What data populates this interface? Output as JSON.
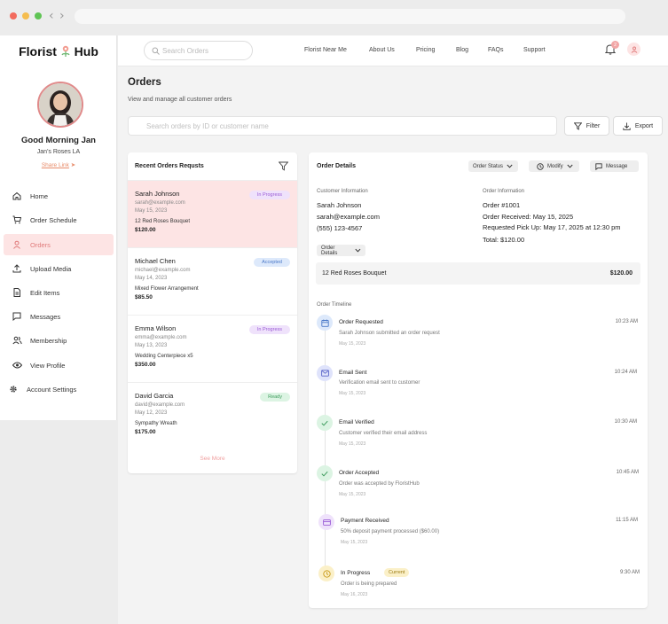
{
  "browser": {
    "url": ""
  },
  "brand": {
    "name_left": "Florist",
    "name_right": "Hub",
    "accent": "#e07a7a"
  },
  "profile": {
    "greeting": "Good Morning Jan",
    "shop": "Jan's Roses LA",
    "share_label": "Share Link"
  },
  "sidebar": {
    "items": [
      {
        "label": "Home",
        "icon": "home-icon"
      },
      {
        "label": "Order Schedule",
        "icon": "cart-icon"
      },
      {
        "label": "Orders",
        "icon": "user-icon",
        "active": true
      },
      {
        "label": "Upload Media",
        "icon": "upload-icon"
      },
      {
        "label": "Edit Items",
        "icon": "document-icon"
      },
      {
        "label": "Messages",
        "icon": "message-icon"
      },
      {
        "label": "Membership",
        "icon": "users-icon"
      },
      {
        "label": "View Profile",
        "icon": "eye-icon"
      },
      {
        "label": "Account Settings",
        "icon": "gear-icon"
      }
    ]
  },
  "topbar": {
    "search_placeholder": "Search Orders",
    "nav": [
      "Florist Near Me",
      "About Us",
      "Pricing",
      "Blog",
      "FAQs",
      "Support"
    ],
    "notification_count": "2"
  },
  "page": {
    "title": "Orders",
    "subtitle": "View and manage all customer orders",
    "search_placeholder": "Search orders by ID or customer name",
    "filter_label": "Filter",
    "export_label": "Export"
  },
  "orders_panel": {
    "title": "Recent Orders Requsts",
    "see_more": "See More",
    "orders": [
      {
        "name": "Sarah Johnson",
        "email": "sarah@example.com",
        "date": "May 15, 2023",
        "item": "12 Red Roses Bouquet",
        "price": "$120.00",
        "status": "In Progress"
      },
      {
        "name": "Michael Chen",
        "email": "michael@example.com",
        "date": "May 14, 2023",
        "item": "Mixed Flower Arrangement",
        "price": "$85.50",
        "status": "Accepted"
      },
      {
        "name": "Emma Wilson",
        "email": "emma@example.com",
        "date": "May 13, 2023",
        "item": "Wedding Centerpiece x5",
        "price": "$350.00",
        "status": "In Progress"
      },
      {
        "name": "David Garcia",
        "email": "david@example.com",
        "date": "May 12, 2023",
        "item": "Sympathy Wreath",
        "price": "$175.00",
        "status": "Ready"
      }
    ]
  },
  "details": {
    "title": "Order Details",
    "status_dd": "Order Status",
    "modify_dd": "Modify",
    "message_btn": "Message",
    "customer_label": "Customer Information",
    "customer_name": "Sarah Johnson",
    "customer_email": "sarah@example.com",
    "customer_phone": "(555) 123-4567",
    "order_label": "Order Information",
    "order_no": "Order #1001",
    "received": "Order Received: May 15, 2025",
    "pickup": "Requested Pick Up: May 17, 2025 at 12:30 pm",
    "total": "Total: $120.00",
    "details_dd": "Order Details",
    "line_item": "12 Red Roses Bouquet",
    "line_price": "$120.00",
    "timeline_label": "Order Timeline",
    "current_label": "Current",
    "timeline": [
      {
        "title": "Order Requested",
        "desc": "Sarah Johnson submitted an order request",
        "date": "May 15, 2023",
        "time": "10:23 AM",
        "icon": "calendar-icon"
      },
      {
        "title": "Email Sent",
        "desc": "Verification email sent to customer",
        "date": "May 15, 2023",
        "time": "10:24 AM",
        "icon": "mail-icon"
      },
      {
        "title": "Email Verified",
        "desc": "Customer verified their email address",
        "date": "May 15, 2023",
        "time": "10:30 AM",
        "icon": "check-icon"
      },
      {
        "title": "Order Accepted",
        "desc": "Order was accepted by FloristHub",
        "date": "May 15, 2023",
        "time": "10:45 AM",
        "icon": "check-icon"
      },
      {
        "title": "Payment Received",
        "desc": "50% deposit payment processed ($60.00)",
        "date": "May 15, 2023",
        "time": "11:15 AM",
        "icon": "card-icon"
      },
      {
        "title": "In Progress",
        "desc": "Order is being prepared",
        "date": "May 16, 2023",
        "time": "9:30 AM",
        "icon": "clock-icon"
      }
    ]
  },
  "status_colors": {
    "In Progress": "#efe2fb",
    "Accepted": "#dde9fb",
    "Ready": "#dcf4e3"
  }
}
